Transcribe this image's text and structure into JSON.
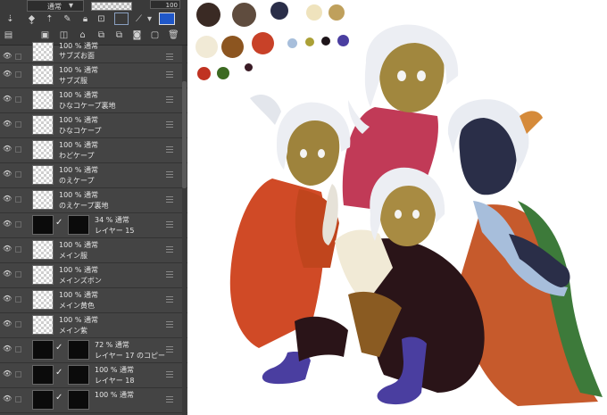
{
  "layer_panel": {
    "toolbar": {
      "blend_mode": "通常",
      "opacity_value": "100"
    },
    "layers": [
      {
        "opacity": "100 %",
        "mode": "通常",
        "name": "サブズお面",
        "partial": true
      },
      {
        "opacity": "100 %",
        "mode": "通常",
        "name": "サブズ服"
      },
      {
        "opacity": "100 %",
        "mode": "通常",
        "name": "ひなコケープ裏地"
      },
      {
        "opacity": "100 %",
        "mode": "通常",
        "name": "ひなコケープ"
      },
      {
        "opacity": "100 %",
        "mode": "通常",
        "name": "わどケープ"
      },
      {
        "opacity": "100 %",
        "mode": "通常",
        "name": "のえケープ"
      },
      {
        "opacity": "100 %",
        "mode": "通常",
        "name": "のえケープ裏地"
      },
      {
        "opacity": "34 %",
        "mode": "通常",
        "name": "レイヤー 15",
        "masked": true
      },
      {
        "opacity": "100 %",
        "mode": "通常",
        "name": "メイン服"
      },
      {
        "opacity": "100 %",
        "mode": "通常",
        "name": "メインズボン"
      },
      {
        "opacity": "100 %",
        "mode": "通常",
        "name": "メイン黄色"
      },
      {
        "opacity": "100 %",
        "mode": "通常",
        "name": "メイン紫"
      },
      {
        "opacity": "72 %",
        "mode": "通常",
        "name": "レイヤー 17 のコピー",
        "masked": true
      },
      {
        "opacity": "100 %",
        "mode": "通常",
        "name": "レイヤー 18",
        "masked": true
      },
      {
        "opacity": "100 %",
        "mode": "通常",
        "name": "",
        "masked": true,
        "partial": true
      }
    ]
  },
  "canvas": {
    "palette_colors": [
      "#3a2a24",
      "#5f4c3e",
      "#2a2e48",
      "#efe3bd",
      "#bfa05c",
      "#f1ead6",
      "#8c5520",
      "#c84128",
      "#a7bedb",
      "#aba036",
      "#1d1419",
      "#4a3ea0",
      "#c03221",
      "#3c6a21",
      "#3a1b25"
    ]
  }
}
